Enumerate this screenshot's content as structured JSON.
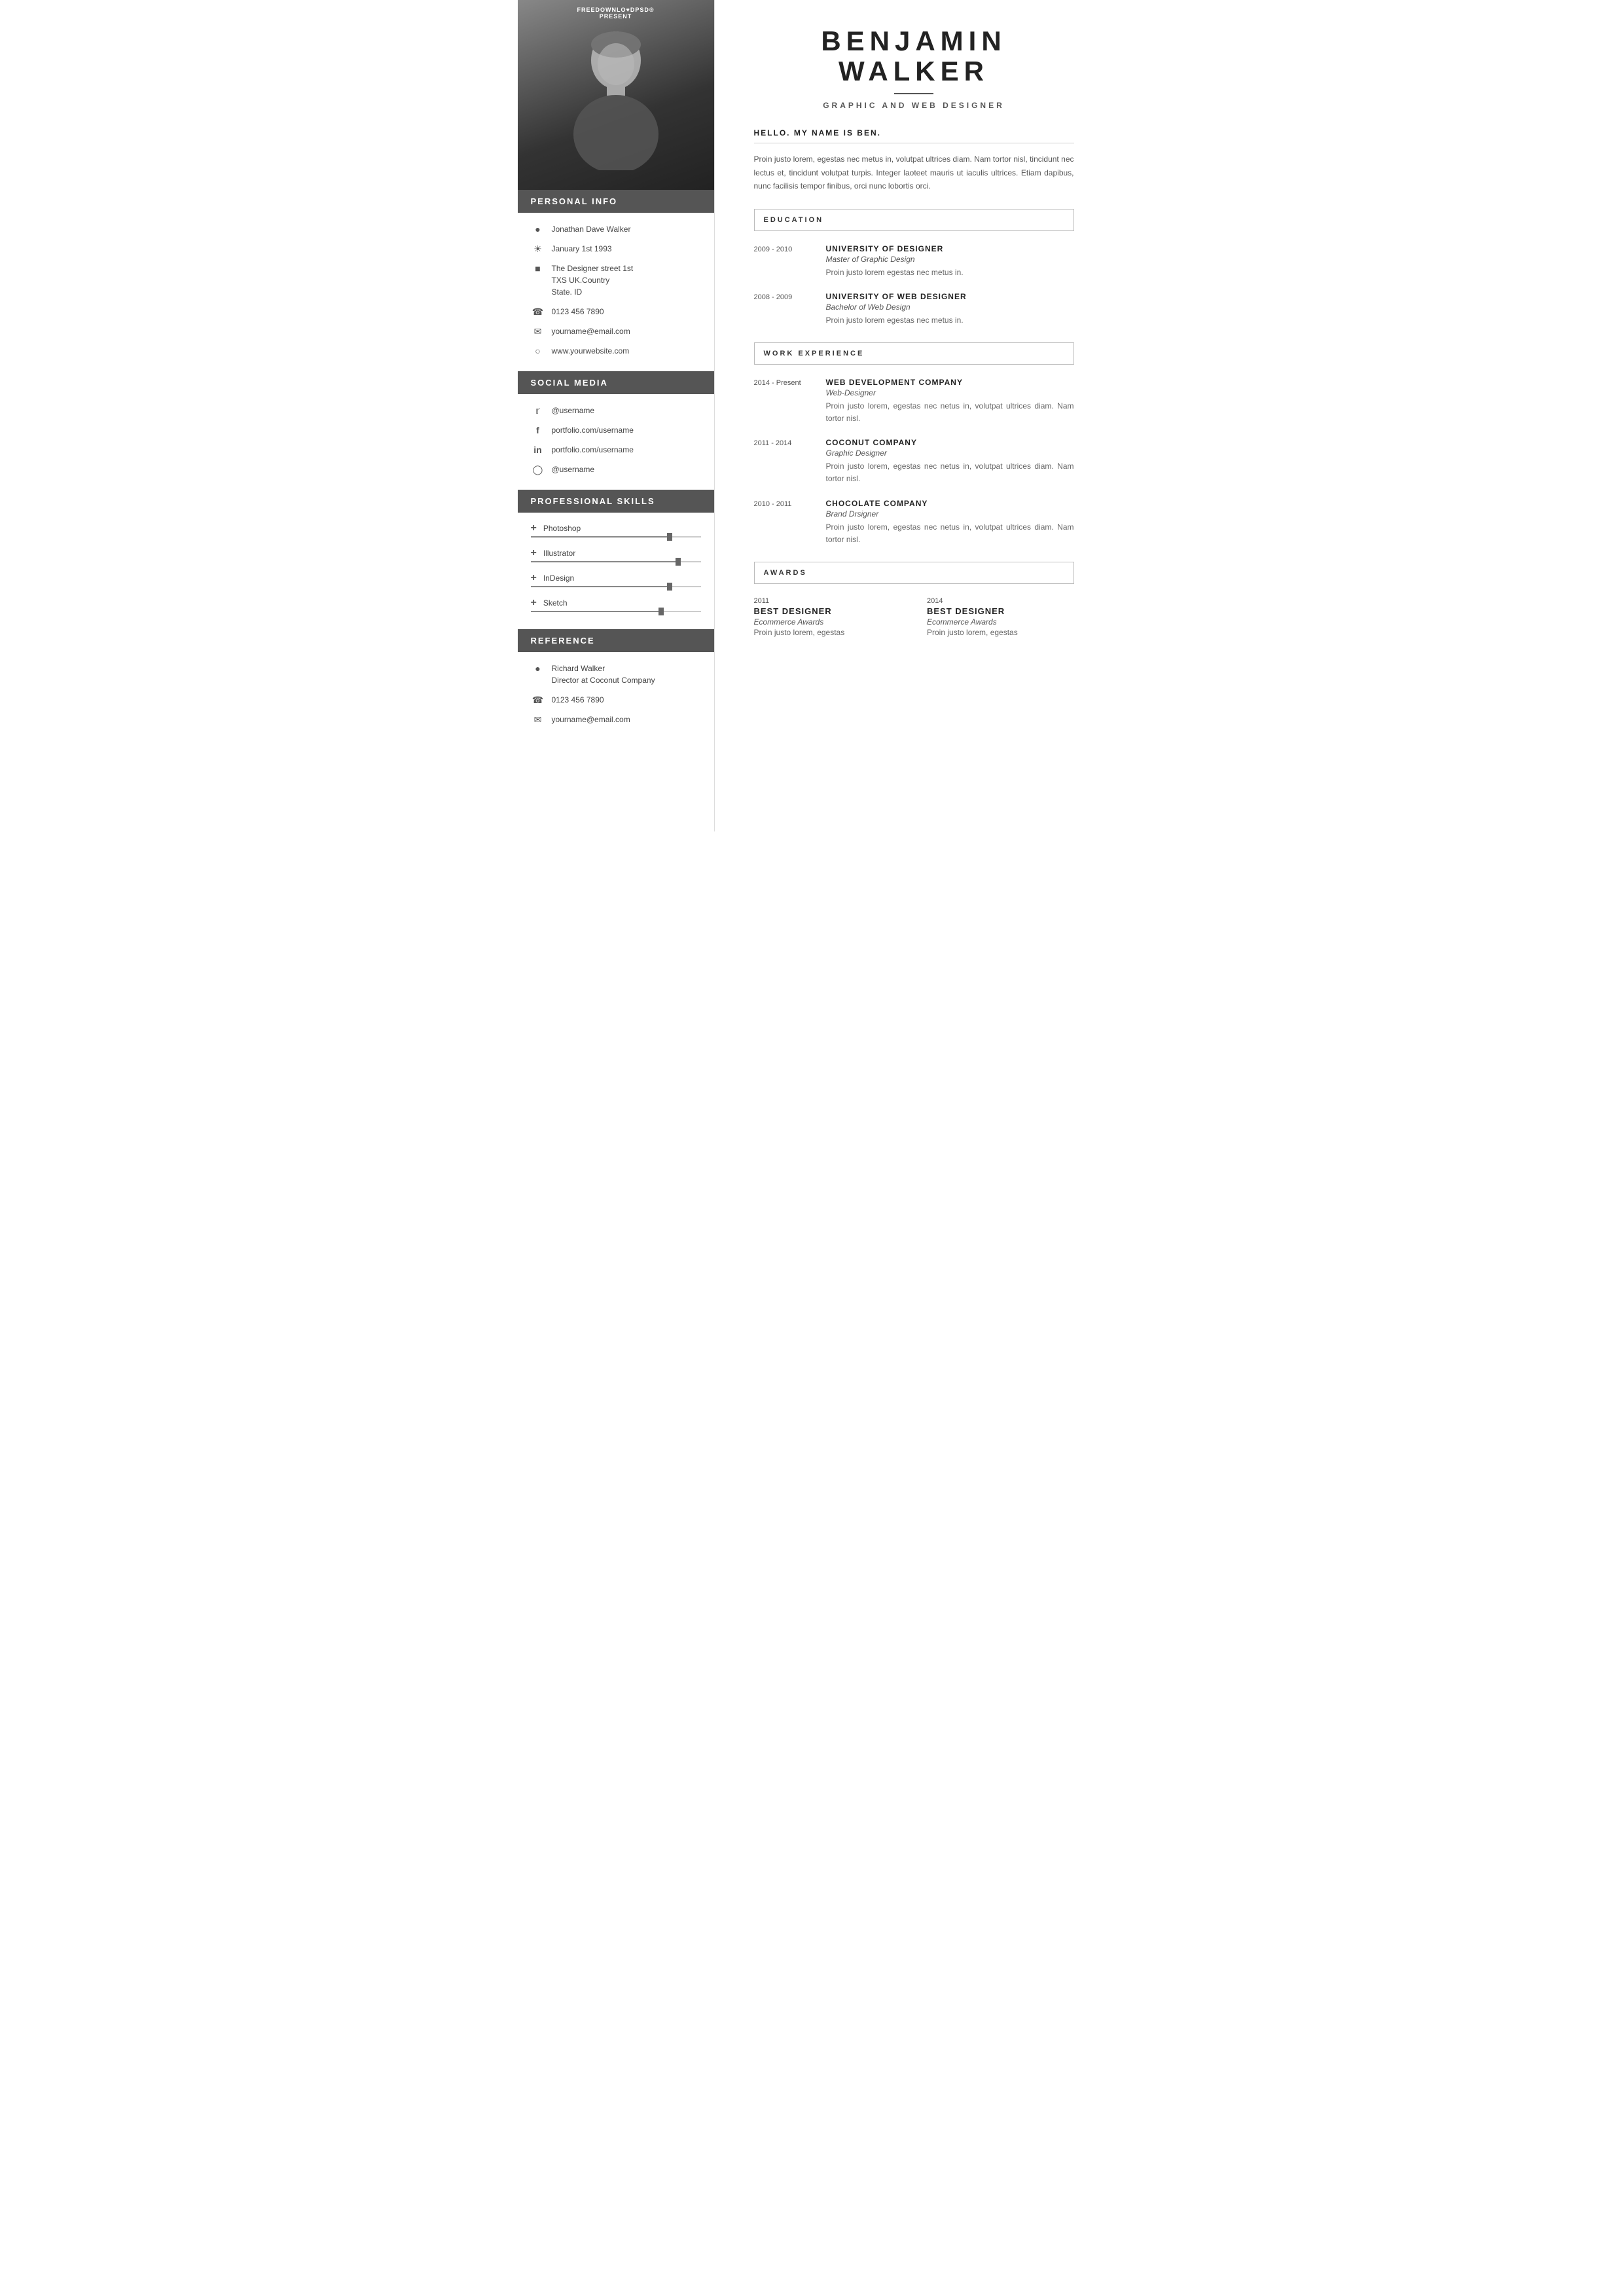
{
  "logo": {
    "line1": "FREEDOWNLO♥DPSD®",
    "line2": "PRESENT"
  },
  "name": {
    "first": "BENJAMIN",
    "last": "WALKER",
    "job_title": "GRAPHIC AND WEB DESIGNER"
  },
  "greeting": "HELLO. MY NAME IS BEN.",
  "intro_text": "Proin justo lorem, egestas nec metus in, volutpat ultrices diam. Nam tortor nisl, tincidunt nec lectus et, tincidunt volutpat turpis. Integer laoteet mauris ut iaculis ultrices. Etiam dapibus, nunc facilisis tempor finibus, orci nunc lobortis orci.",
  "personal_info": {
    "section_title": "PERSONAL INFO",
    "name": "Jonathan Dave Walker",
    "dob": "January 1st 1993",
    "address": "The Designer street 1st\nTXS UK.Country\nState. ID",
    "phone": "0123 456 7890",
    "email": "yourname@email.com",
    "website": "www.yourwebsite.com"
  },
  "social_media": {
    "section_title": "SOCIAL MEDIA",
    "twitter": "@username",
    "facebook": "portfolio.com/username",
    "linkedin": "portfolio.com/username",
    "instagram": "@username"
  },
  "skills": {
    "section_title": "PROFESSIONAL  SKILLS",
    "items": [
      {
        "name": "Photoshop",
        "percent": 80
      },
      {
        "name": "Illustrator",
        "percent": 85
      },
      {
        "name": "InDesign",
        "percent": 80
      },
      {
        "name": "Sketch",
        "percent": 75
      }
    ]
  },
  "reference": {
    "section_title": "REFERENCE",
    "name": "Richard Walker",
    "title": "Director at Coconut Company",
    "phone": "0123 456 7890",
    "email": "yourname@email.com"
  },
  "education": {
    "section_title": "EDUCATION",
    "entries": [
      {
        "date": "2009 - 2010",
        "company": "UNIVERSITY OF DESIGNER",
        "role": "Master of Graphic Design",
        "desc": "Proin justo lorem egestas nec metus in."
      },
      {
        "date": "2008 - 2009",
        "company": "UNIVERSITY OF WEB DESIGNER",
        "role": "Bachelor of Web Design",
        "desc": "Proin justo lorem egestas nec metus in."
      }
    ]
  },
  "work_experience": {
    "section_title": "WORK EXPERIENCE",
    "entries": [
      {
        "date": "2014 - Present",
        "company": "WEB DEVELOPMENT COMPANY",
        "role": "Web-Designer",
        "desc": "Proin justo lorem, egestas nec netus in, volutpat ultrices diam. Nam tortor nisl."
      },
      {
        "date": "2011 - 2014",
        "company": "COCONUT COMPANY",
        "role": "Graphic Designer",
        "desc": "Proin justo lorem, egestas nec netus in, volutpat ultrices diam. Nam tortor nisl."
      },
      {
        "date": "2010 - 2011",
        "company": "CHOCOLATE  COMPANY",
        "role": "Brand Drsigner",
        "desc": "Proin justo lorem, egestas nec netus in, volutpat ultrices diam. Nam tortor nisl."
      }
    ]
  },
  "awards": {
    "section_title": "AWARDS",
    "entries": [
      {
        "year": "2011",
        "title": "BEST  DESIGNER",
        "org": "Ecommerce Awards",
        "desc": "Proin justo  lorem, egestas"
      },
      {
        "year": "2014",
        "title": "BEST  DESIGNER",
        "org": "Ecommerce Awards",
        "desc": "Proin justo  lorem, egestas"
      }
    ]
  }
}
